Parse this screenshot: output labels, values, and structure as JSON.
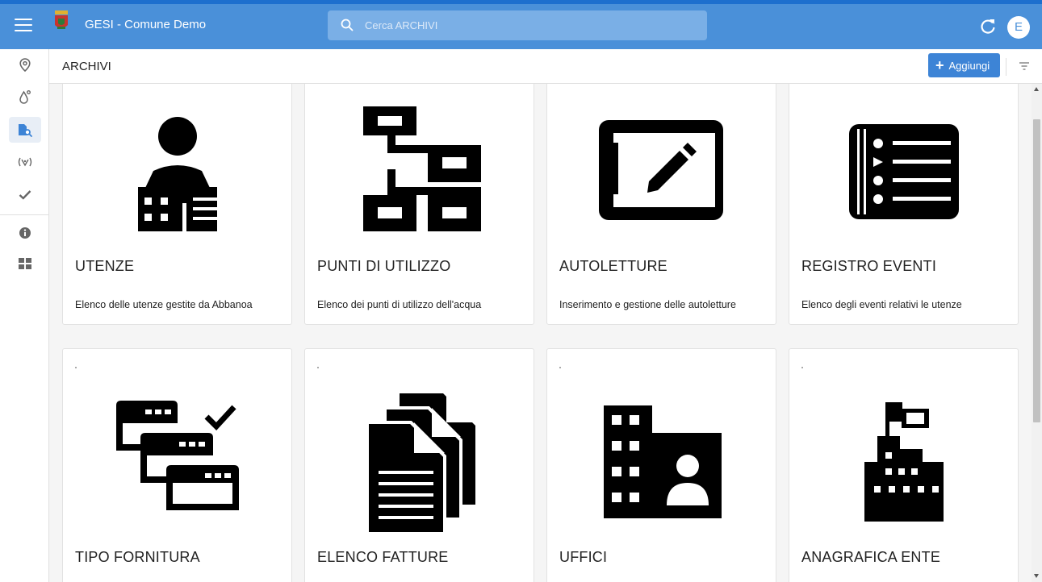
{
  "app": {
    "title": "GESI - Comune Demo",
    "avatar_initial": "E"
  },
  "search": {
    "placeholder": "Cerca ARCHIVI",
    "icon": "search-icon"
  },
  "header": {
    "title": "ARCHIVI",
    "add_label": "Aggiungi"
  },
  "sidebar": {
    "items": [
      {
        "icon": "location-pin-icon"
      },
      {
        "icon": "water-drop-icon"
      },
      {
        "icon": "archive-search-icon",
        "active": true
      },
      {
        "icon": "meter-signal-icon"
      },
      {
        "icon": "check-icon"
      },
      {
        "icon": "info-icon"
      },
      {
        "icon": "grid-icon"
      }
    ]
  },
  "cards": [
    {
      "title": "UTENZE",
      "description": "Elenco delle utenze gestite da Abbanoa",
      "icon": "user-buildings-icon"
    },
    {
      "title": "PUNTI DI UTILIZZO",
      "description": "Elenco dei punti di utilizzo dell'acqua",
      "icon": "hierarchy-icon"
    },
    {
      "title": "AUTOLETTURE",
      "description": "Inserimento e gestione delle autoletture",
      "icon": "tablet-edit-icon"
    },
    {
      "title": "REGISTRO EVENTI",
      "description": "Elenco degli eventi relativi le utenze",
      "icon": "event-list-icon"
    },
    {
      "title": "TIPO FORNITURA",
      "description": "",
      "icon": "stacked-windows-check-icon"
    },
    {
      "title": "ELENCO FATTURE",
      "description": "",
      "icon": "documents-icon"
    },
    {
      "title": "UFFICI",
      "description": "",
      "icon": "office-person-icon"
    },
    {
      "title": "ANAGRAFICA ENTE",
      "description": "",
      "icon": "building-flag-icon"
    }
  ],
  "colors": {
    "topbar": "#4a90d9",
    "accent": "#3d84d6",
    "search_bg": "#7aafe6"
  }
}
